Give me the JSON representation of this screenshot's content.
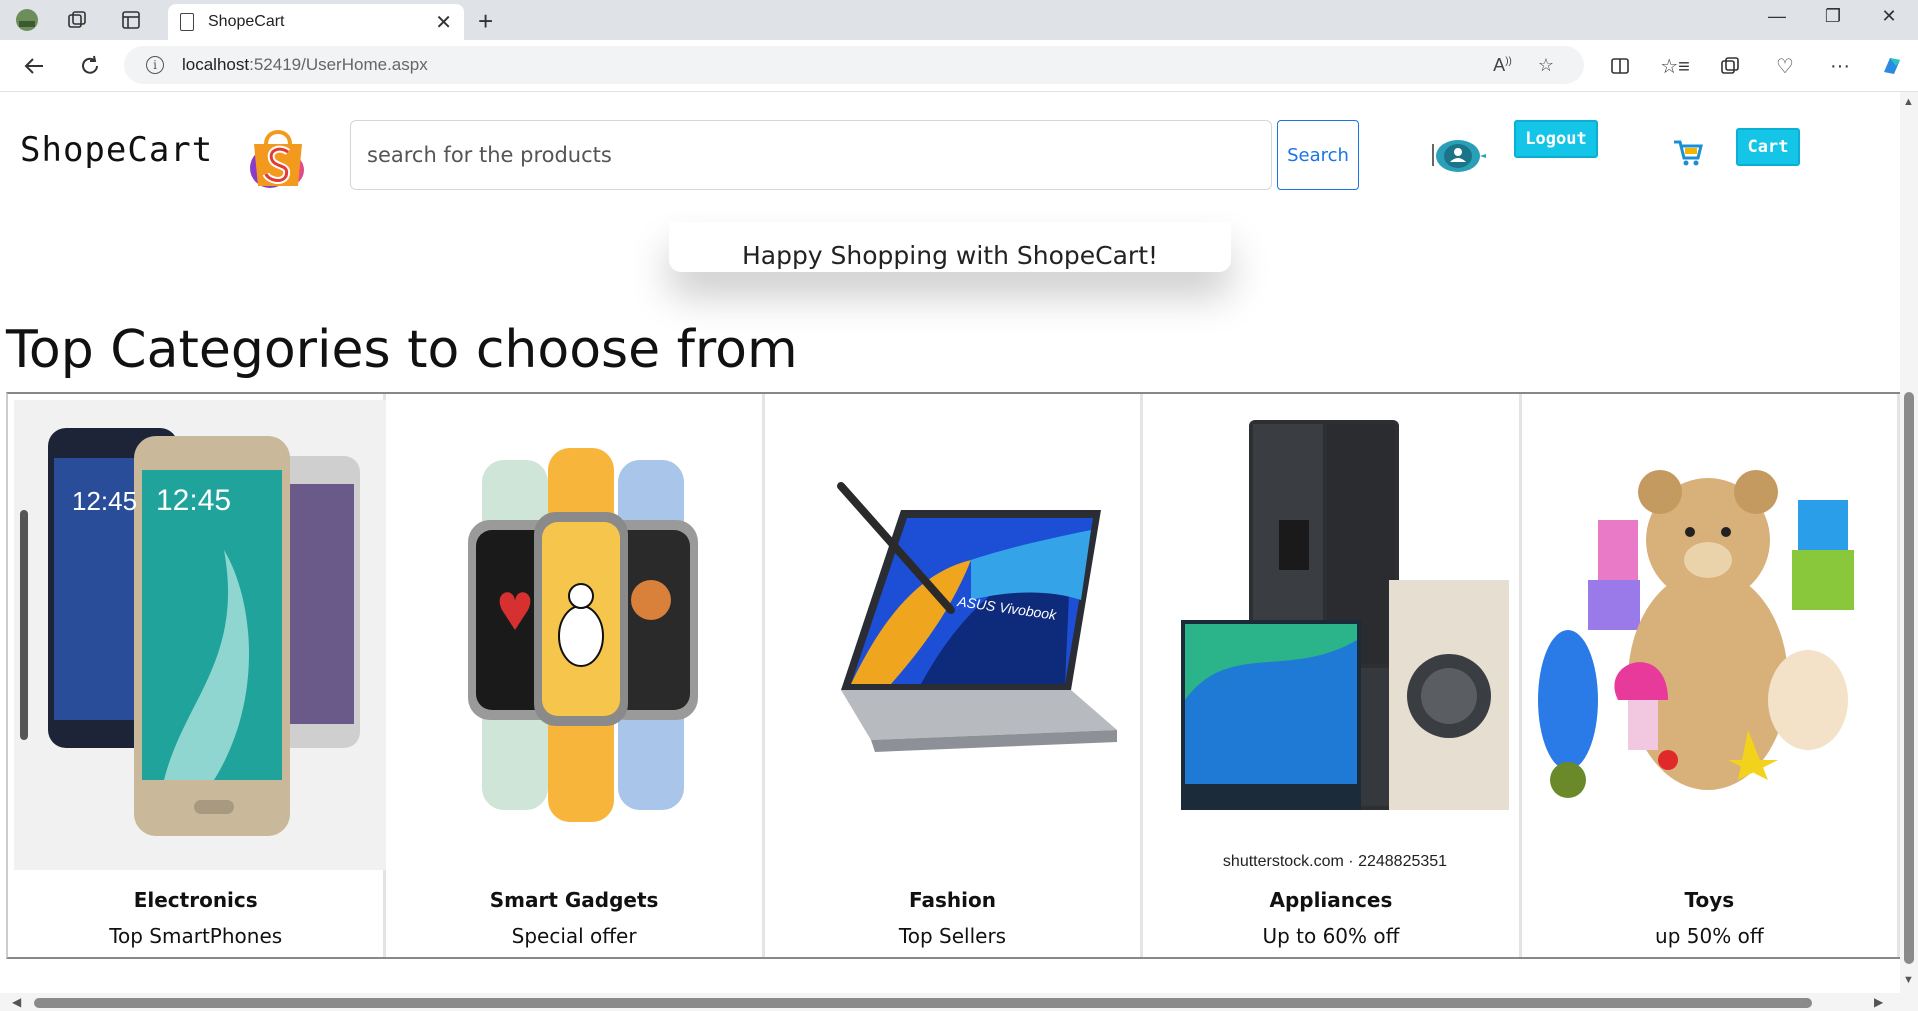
{
  "browser": {
    "tab_title": "ShopeCart",
    "new_tab": "+",
    "url_host": "localhost",
    "url_path": ":52419/UserHome.aspx",
    "window": {
      "minimize": "—",
      "restore": "❐",
      "close": "✕"
    }
  },
  "header": {
    "brand": "ShopeCart",
    "search_placeholder": "search for the products",
    "search_button": "Search",
    "logout_button": "Logout",
    "cart_button": "Cart"
  },
  "banner": {
    "text": "Happy Shopping with ShopeCart!"
  },
  "categories": {
    "title": "Top Categories to choose from",
    "items": [
      {
        "name": "Electronics",
        "subtitle": "Top SmartPhones",
        "icon": "smartphones-image"
      },
      {
        "name": "Smart Gadgets",
        "subtitle": "Special offer",
        "icon": "smartwatches-image"
      },
      {
        "name": "Fashion",
        "subtitle": "Top Sellers",
        "icon": "laptop-image"
      },
      {
        "name": "Appliances",
        "subtitle": "Up to 60% off",
        "icon": "appliances-image",
        "caption": "shutterstock.com · 2248825351"
      },
      {
        "name": "Toys",
        "subtitle": "up 50% off",
        "icon": "toys-image"
      }
    ]
  },
  "phone_time": "12:45",
  "laptop_label": "ASUS Vivobook",
  "colors": {
    "accent": "#14c5e8",
    "link": "#1a73e8"
  }
}
